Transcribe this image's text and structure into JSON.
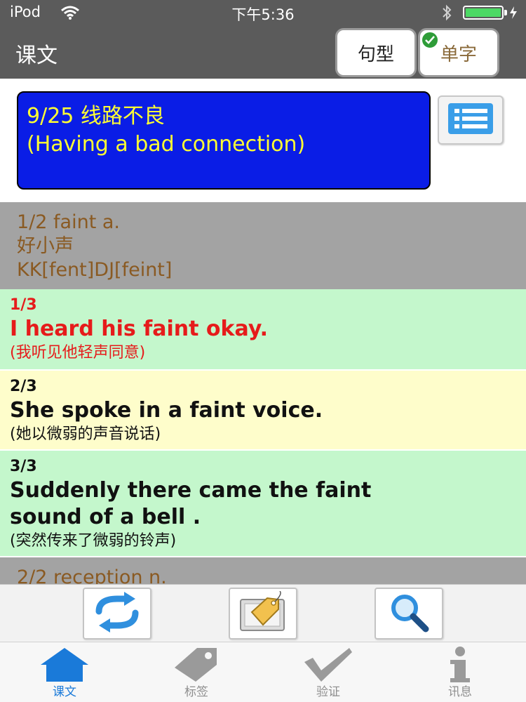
{
  "status_bar": {
    "carrier": "iPod",
    "time": "下午5:36",
    "battery_level": 1.0,
    "icons": [
      "wifi-icon",
      "bluetooth-icon",
      "battery-icon",
      "charging-icon"
    ]
  },
  "nav": {
    "title": "课文",
    "sentence_button": "句型",
    "word_button": "单字",
    "word_button_checked": true
  },
  "lesson": {
    "line1": "9/25 线路不良",
    "line2": "(Having a bad connection)",
    "list_button_icon": "list-icon"
  },
  "entries": [
    {
      "header": {
        "line1": "1/2 faint   a.",
        "line2": "好小声",
        "line3": "KK[fent]DJ[feint]"
      },
      "examples": [
        {
          "num": "1/3",
          "en": "I heard his faint okay.",
          "zh": "(我听见他轻声同意)",
          "highlight": "red",
          "bg": "green"
        },
        {
          "num": "2/3",
          "en": "She spoke in a faint voice.",
          "zh": "(她以微弱的声音说话)",
          "highlight": "dark",
          "bg": "yellow"
        },
        {
          "num": "3/3",
          "en_line1": "Suddenly there came the faint",
          "en_line2": "sound of a bell .",
          "zh": "(突然传来了微弱的铃声)",
          "highlight": "dark",
          "bg": "green"
        }
      ]
    },
    {
      "header": {
        "line1": "2/2 reception   n."
      }
    }
  ],
  "toolbar": {
    "buttons": [
      "repeat-icon",
      "tag-icon",
      "search-icon"
    ]
  },
  "tabs": [
    {
      "label": "课文",
      "icon": "home-icon",
      "active": true
    },
    {
      "label": "标签",
      "icon": "tag-icon",
      "active": false
    },
    {
      "label": "验证",
      "icon": "checkmark-icon",
      "active": false
    },
    {
      "label": "讯息",
      "icon": "info-icon",
      "active": false
    }
  ],
  "colors": {
    "bar_gray": "#5b5b5b",
    "lesson_blue": "#0a1de6",
    "lesson_text": "#ffff33",
    "word_header_bg": "#a3a3a3",
    "word_header_text": "#8a5a22",
    "example_green": "#c4f7cc",
    "example_yellow": "#fefdcb",
    "highlight_red": "#e61b1b",
    "tab_active": "#1a7ad9"
  }
}
